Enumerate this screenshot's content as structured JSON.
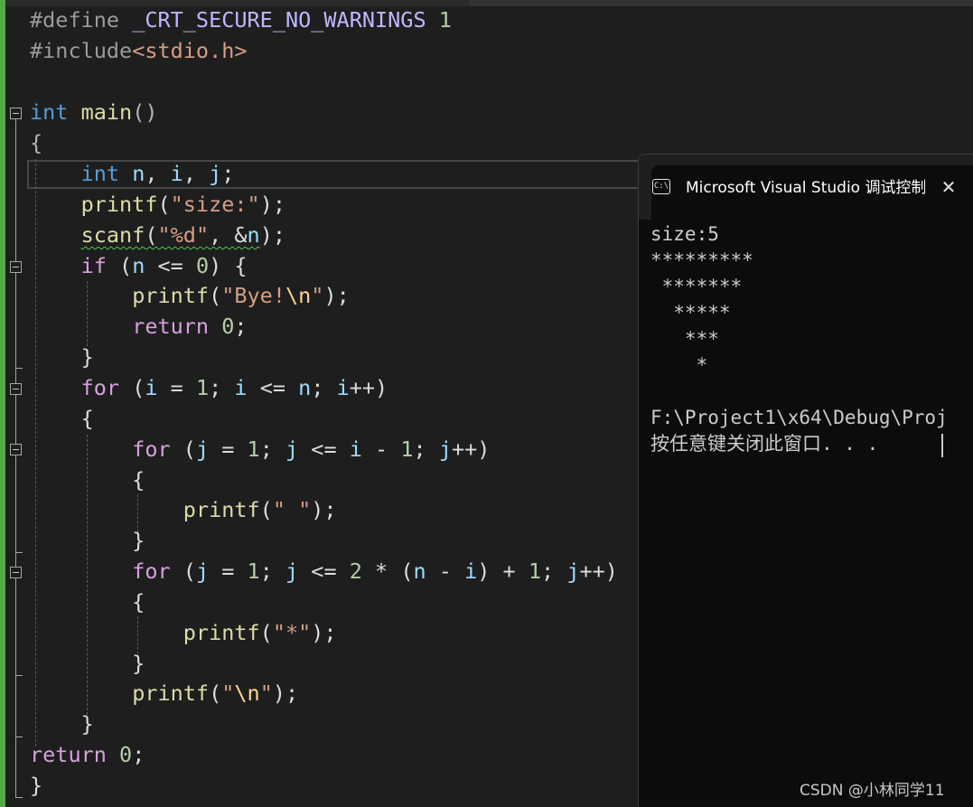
{
  "editor": {
    "lines": [
      "#define _CRT_SECURE_NO_WARNINGS 1",
      "#include<stdio.h>",
      "",
      "int main()",
      "{",
      "    int n, i, j;",
      "    printf(\"size:\");",
      "    scanf(\"%d\", &n);",
      "    if (n <= 0) {",
      "        printf(\"Bye!\\n\");",
      "        return 0;",
      "    }",
      "    for (i = 1; i <= n; i++)",
      "    {",
      "        for (j = 1; j <= i - 1; j++)",
      "        {",
      "            printf(\" \");",
      "        }",
      "        for (j = 1; j <= 2 * (n - i) + 1; j++)",
      "        {",
      "            printf(\"*\");",
      "        }",
      "        printf(\"\\n\");",
      "    }",
      "return 0;",
      "}"
    ]
  },
  "console": {
    "icon_text": "C:\\",
    "title": "Microsoft Visual Studio 调试控制台",
    "close_glyph": "✕",
    "output_lines": [
      "size:5",
      "*********",
      " *******",
      "  *****",
      "   ***",
      "    *",
      "",
      "F:\\Project1\\x64\\Debug\\Proj",
      "按任意键关闭此窗口. . ."
    ]
  },
  "watermark": "CSDN @小林同学11",
  "colors": {
    "editor_bg": "#1e1e1e",
    "keyword": "#569cd6",
    "control_keyword": "#d8a0df",
    "function": "#dcdcaa",
    "string": "#d69d85",
    "number": "#b5cea8",
    "variable": "#9cdcfe",
    "preprocessor": "#9b9b9b",
    "macro": "#beb7ff",
    "change_bar": "#57a64a",
    "console_bg": "#0c0c0c"
  }
}
